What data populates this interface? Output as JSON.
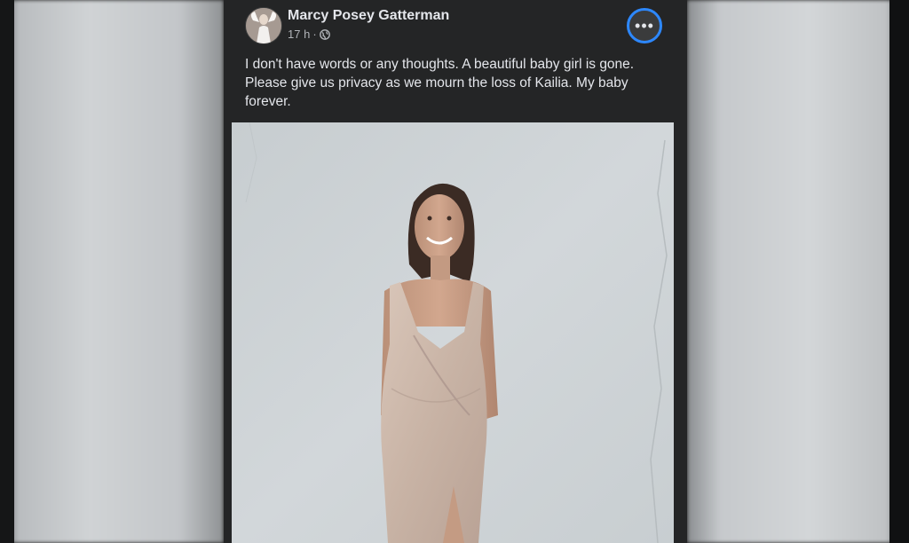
{
  "post": {
    "author_name": "Marcy Posey Gatterman",
    "timestamp": "17 h",
    "separator": "·",
    "privacy_icon": "globe-icon",
    "more_icon": "more-options-icon",
    "more_label": "•••",
    "text": "I don't have words or any thoughts. A beautiful baby girl is gone. Please give us privacy as we mourn the loss of Kailia. My baby forever.",
    "photo_icon": "portrait-photo"
  },
  "colors": {
    "post_background": "#242526",
    "text_primary": "#e4e6eb",
    "text_secondary": "#b0b3b8",
    "focus_ring": "#2d88ff"
  }
}
